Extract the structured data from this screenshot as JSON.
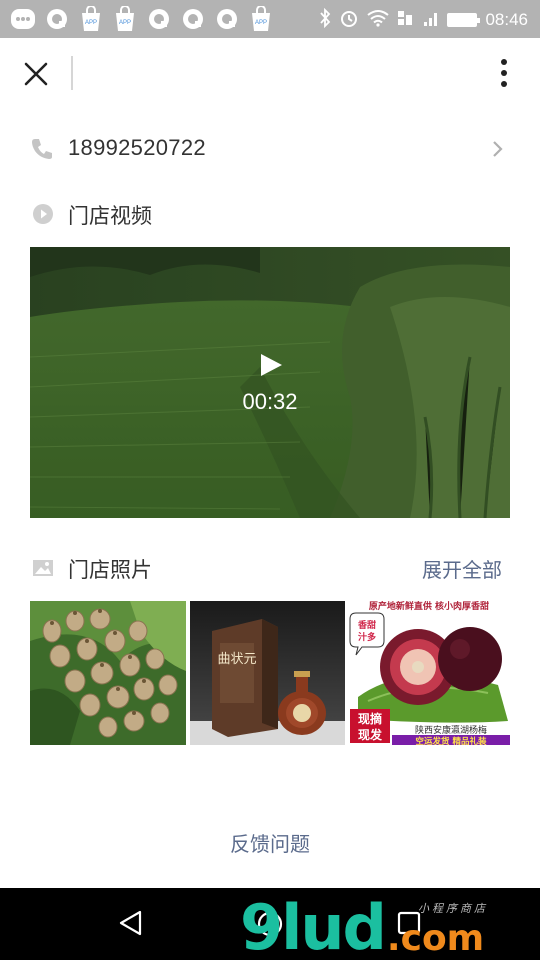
{
  "status_bar": {
    "time": "08:46",
    "app_icons": [
      "chat-app-icon",
      "browser-icon",
      "app-store-icon",
      "app-store-icon",
      "browser-icon",
      "browser-icon",
      "browser-icon",
      "app-store-icon"
    ],
    "app_store_label": "APP"
  },
  "store": {
    "phone": "18992520722",
    "video_section_title": "门店视频",
    "video_duration": "00:32",
    "photos_section_title": "门店照片",
    "expand_all_label": "展开全部",
    "feedback_label": "反馈问题"
  },
  "photos": [
    {
      "name": "loquat-fruit-photo",
      "caption_lines": []
    },
    {
      "name": "liquor-bottle-photo",
      "brand": "曲状元"
    },
    {
      "name": "waxberry-ad-photo",
      "banner_top": "原产地新鲜直供 核小肉厚香甜",
      "bubble": "香甜\n汁多",
      "badge_line1": "现摘",
      "badge_line2": "现发",
      "caption": "陕西安康瀛湖杨梅",
      "bottom_banner": "空运发货 精品礼装"
    }
  ],
  "watermark": {
    "main": "9lud",
    "suffix": ".com",
    "sub": "小程序商店"
  },
  "colors": {
    "status_bar": "#b3b3b3",
    "link": "#5b6b8c",
    "watermark_green": "#1bbfa0",
    "watermark_orange": "#f08a1c"
  }
}
